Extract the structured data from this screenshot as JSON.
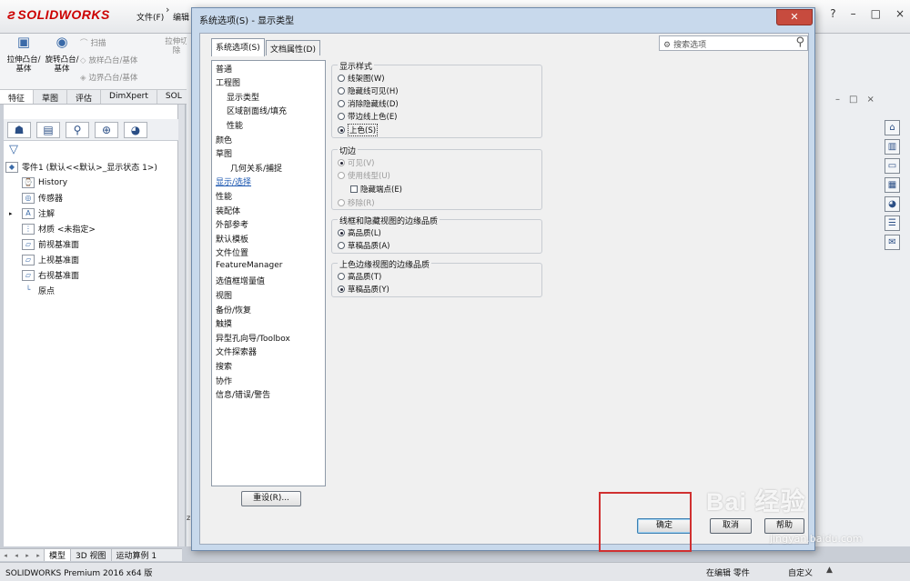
{
  "app": {
    "logo": "SOLIDWORKS",
    "menu": [
      "文件(F)",
      "编辑"
    ],
    "window_controls": [
      "?",
      "–",
      "□",
      "×"
    ]
  },
  "ribbon": {
    "extrude_boss": "拉伸凸台/基体",
    "revolve_boss": "旋转凸台/基体",
    "sweep": "扫描",
    "loft": "放样凸台/基体",
    "boundary": "边界凸台/基体",
    "extrude_cut": "拉伸切除"
  },
  "command_tabs": [
    "特征",
    "草图",
    "评估",
    "DimXpert",
    "SOL"
  ],
  "feature_tree": {
    "root": "零件1 (默认<<默认>_显示状态 1>)",
    "items": [
      "History",
      "传感器",
      "注解",
      "材质 <未指定>",
      "前视基准面",
      "上视基准面",
      "右视基准面",
      "原点"
    ]
  },
  "dialog": {
    "title": "系统选项(S) - 显示类型",
    "tabs": [
      "系统选项(S)",
      "文档属性(D)"
    ],
    "search_placeholder": "搜索选项",
    "categories": [
      "普通",
      "工程图",
      "显示类型",
      "区域剖面线/填充",
      "性能",
      "颜色",
      "草图",
      "几何关系/捕捉",
      "显示/选择",
      "性能",
      "装配体",
      "外部参考",
      "默认模板",
      "文件位置",
      "FeatureManager",
      "选值框增量值",
      "视图",
      "备份/恢复",
      "触摸",
      "异型孔向导/Toolbox",
      "文件探索器",
      "搜索",
      "协作",
      "信息/错误/警告"
    ],
    "reset_label": "重设(R)...",
    "display_style": {
      "title": "显示样式",
      "options": [
        "线架图(W)",
        "隐藏线可见(H)",
        "消除隐藏线(D)",
        "带边线上色(E)",
        "上色(S)"
      ],
      "selected_index": 4
    },
    "tangent_edges": {
      "title": "切边",
      "options": [
        "可见(V)",
        "使用线型(U)",
        "隐藏端点(E)",
        "移除(R)"
      ],
      "selected_index": 0
    },
    "wireframe_quality": {
      "title": "线框和隐藏视图的边缘品质",
      "options": [
        "高品质(L)",
        "草稿品质(A)"
      ],
      "selected_index": 0
    },
    "shaded_quality": {
      "title": "上色边缘视图的边缘品质",
      "options": [
        "高品质(T)",
        "草稿品质(Y)"
      ],
      "selected_index": 1
    },
    "buttons": {
      "ok": "确定",
      "cancel": "取消",
      "help": "帮助"
    }
  },
  "bottom_tabs": [
    "模型",
    "3D 视图",
    "运动算例 1"
  ],
  "status": {
    "product": "SOLIDWORKS Premium 2016 x64 版",
    "editing": "在编辑 零件",
    "custom": "自定义"
  },
  "watermark": {
    "brand": "Bai 经验",
    "url": "jingyan.baidu.com"
  },
  "colors": {
    "highlight": "#d03030",
    "dialog_frame": "#c8d9ec",
    "selected_link": "#1a56b0"
  }
}
